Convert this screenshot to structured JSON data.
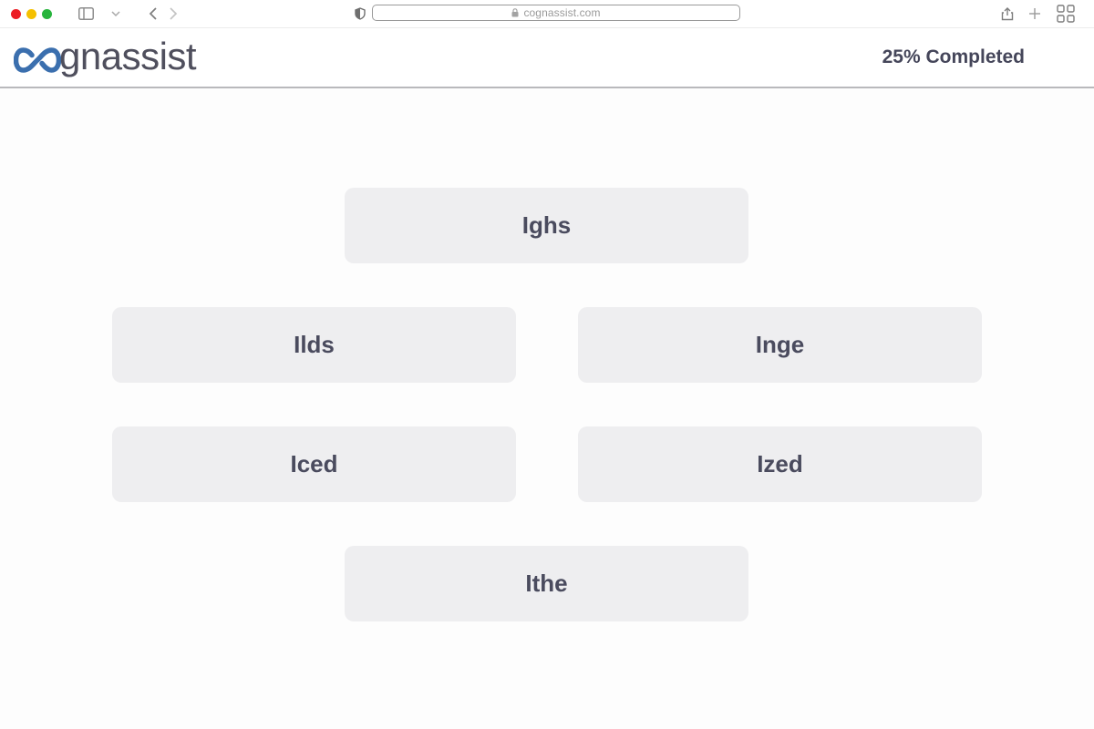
{
  "browser": {
    "url": "cognassist.com",
    "icons": [
      "sidebar-icon",
      "chevron-down-icon",
      "back-icon",
      "forward-icon",
      "shield-icon",
      "lock-icon",
      "share-icon",
      "plus-icon",
      "grid-icon"
    ]
  },
  "header": {
    "logo_text": "gnassist",
    "logo_full": "cognassist",
    "progress_label": "25% Completed",
    "progress_percent": 25
  },
  "options": [
    {
      "label": "Ighs"
    },
    {
      "label": "Ilds"
    },
    {
      "label": "Inge"
    },
    {
      "label": "Iced"
    },
    {
      "label": "Ized"
    },
    {
      "label": "Ithe"
    }
  ],
  "colors": {
    "brand_blue": "#3b6fae",
    "text_dark": "#4a4b5e",
    "option_bg": "#eeeef0",
    "header_border": "#b9b9bc"
  }
}
